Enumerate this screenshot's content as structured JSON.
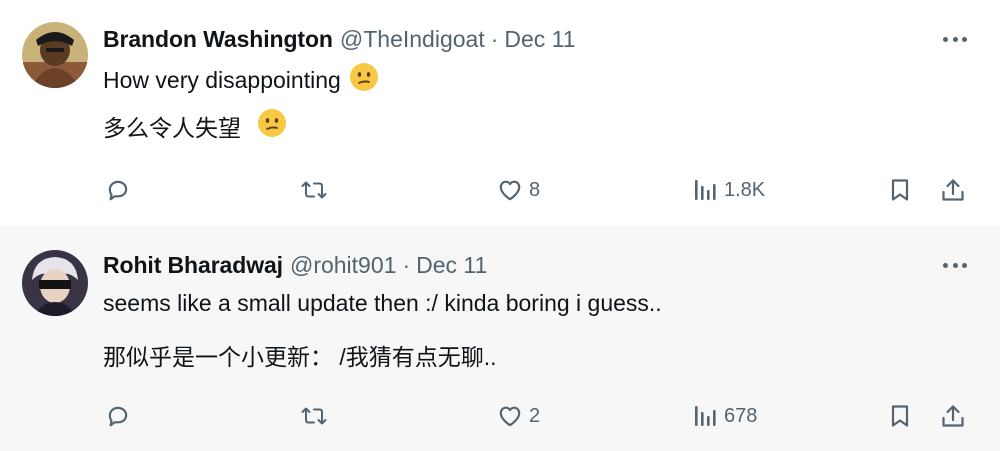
{
  "posts": [
    {
      "name": "Brandon Washington",
      "handle": "@TheIndigoat",
      "separator": "·",
      "date": "Dec 11",
      "line1": "How very disappointing",
      "line2": "多么令人失望",
      "counts": {
        "reply": "",
        "repost": "",
        "like": "8",
        "views": "1.8K"
      }
    },
    {
      "name": "Rohit Bharadwaj",
      "handle": "@rohit901",
      "separator": "·",
      "date": "Dec 11",
      "line1": "seems like a small update then :/ kinda boring i guess..",
      "line2": "那似乎是一个小更新： /我猜有点无聊..",
      "counts": {
        "reply": "",
        "repost": "",
        "like": "2",
        "views": "678"
      }
    }
  ],
  "icons": [
    "avatar",
    "confused-face-emoji",
    "more-icon",
    "reply-icon",
    "repost-icon",
    "like-icon",
    "views-icon",
    "bookmark-icon",
    "share-icon"
  ],
  "colors": {
    "text": "#0f1419",
    "secondary": "#536471",
    "emoji": "#f6c844"
  }
}
